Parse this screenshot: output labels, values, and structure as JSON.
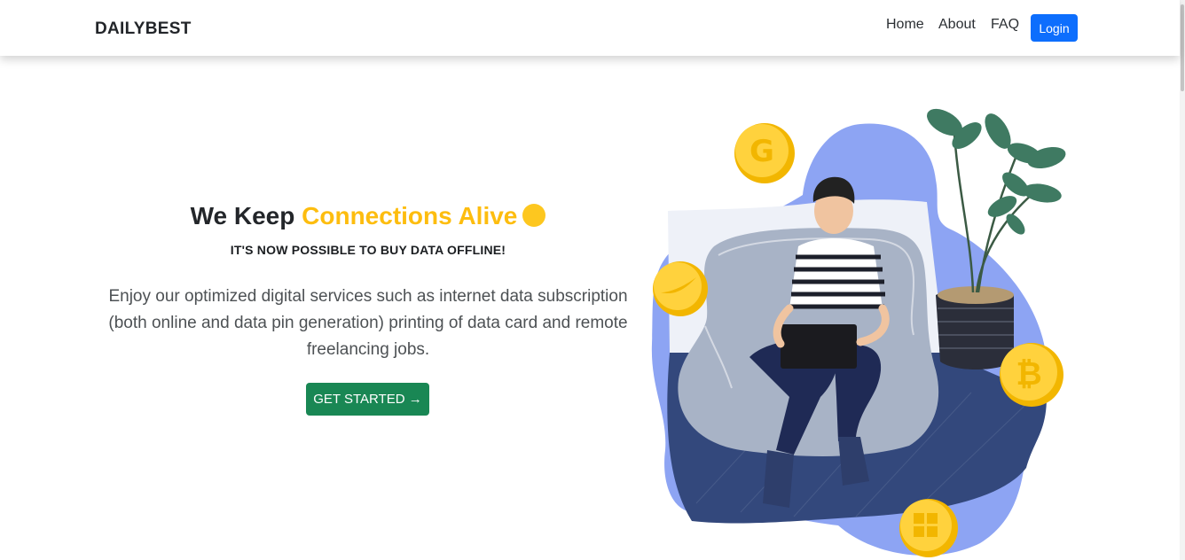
{
  "navbar": {
    "brand": "DAILYBEST",
    "links": [
      "Home",
      "About",
      "FAQ"
    ],
    "login_label": "Login"
  },
  "hero": {
    "title_part1": "We Keep ",
    "title_accent": "Connections Alive",
    "subtitle": "IT'S NOW POSSIBLE TO BUY DATA OFFLINE!",
    "description": "Enjoy our optimized digital services such as internet data subscription (both online and data pin generation) printing of data card and remote freelancing jobs.",
    "cta_label": "GET STARTED →"
  },
  "colors": {
    "accent": "#fdbd0f",
    "login_button": "#0d6efd",
    "cta_button": "#198754",
    "blob": "#8da4f3"
  }
}
